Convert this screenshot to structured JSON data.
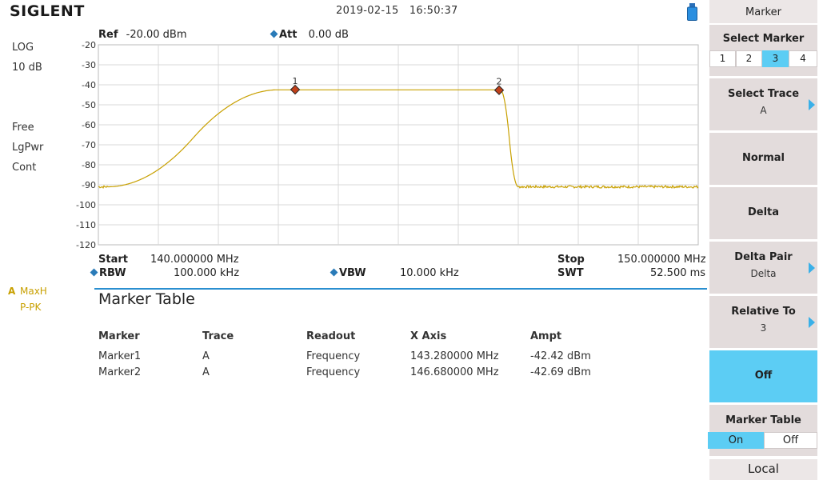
{
  "header": {
    "logo": "SIGLENT",
    "datetime": "2019-02-15   16:50:37"
  },
  "left": {
    "scale": "LOG",
    "scale_div": "10 dB",
    "trigger": "Free",
    "detector": "LgPwr",
    "sweep": "Cont",
    "trace_label": "A",
    "trace_mode": "MaxH",
    "trace_det": "P-PK"
  },
  "plot": {
    "ref_label": "Ref",
    "ref_value": "-20.00 dBm",
    "att_label": "Att",
    "att_value": "0.00 dB",
    "start_label": "Start",
    "start_value": "140.000000 MHz",
    "stop_label": "Stop",
    "stop_value": "150.000000 MHz",
    "rbw_label": "RBW",
    "rbw_value": "100.000 kHz",
    "vbw_label": "VBW",
    "vbw_value": "10.000 kHz",
    "swt_label": "SWT",
    "swt_value": "52.500 ms"
  },
  "chart_data": {
    "type": "line",
    "xlim": [
      140.0,
      150.0
    ],
    "ylim": [
      -120,
      -20
    ],
    "y_ticks": [
      "-20",
      "-30",
      "-40",
      "-50",
      "-60",
      "-70",
      "-80",
      "-90",
      "-100",
      "-110",
      "-120"
    ],
    "grid": true,
    "trace_color": "#c8a000",
    "noise_floor": -91,
    "plateau_level": -42.5,
    "rise_start": 140.15,
    "plateau_start": 143.0,
    "plateau_end": 146.7,
    "fall_end": 147.0,
    "markers": [
      {
        "label": "1",
        "x": 143.28,
        "y": -42.42
      },
      {
        "label": "2",
        "x": 146.68,
        "y": -42.69
      }
    ]
  },
  "marker_table": {
    "title": "Marker Table",
    "columns": [
      "Marker",
      "Trace",
      "Readout",
      "X Axis",
      "Ampt"
    ],
    "rows": [
      [
        "Marker1",
        "A",
        "Frequency",
        "143.280000 MHz",
        "-42.42 dBm"
      ],
      [
        "Marker2",
        "A",
        "Frequency",
        "146.680000 MHz",
        "-42.69 dBm"
      ]
    ]
  },
  "menu": {
    "title": "Marker",
    "select_marker": "Select Marker",
    "marker_options": [
      "1",
      "2",
      "3",
      "4"
    ],
    "selected_marker": "3",
    "select_trace": "Select Trace",
    "select_trace_value": "A",
    "normal": "Normal",
    "delta": "Delta",
    "delta_pair": "Delta Pair",
    "delta_pair_value": "Delta",
    "relative_to": "Relative To",
    "relative_to_value": "3",
    "off": "Off",
    "marker_table": "Marker Table",
    "marker_table_on": "On",
    "marker_table_off": "Off",
    "local": "Local"
  },
  "colors": {
    "accent": "#5ccdf4",
    "button": "#e3dcdc",
    "trace": "#c8a000",
    "marker": "#c0401a"
  }
}
